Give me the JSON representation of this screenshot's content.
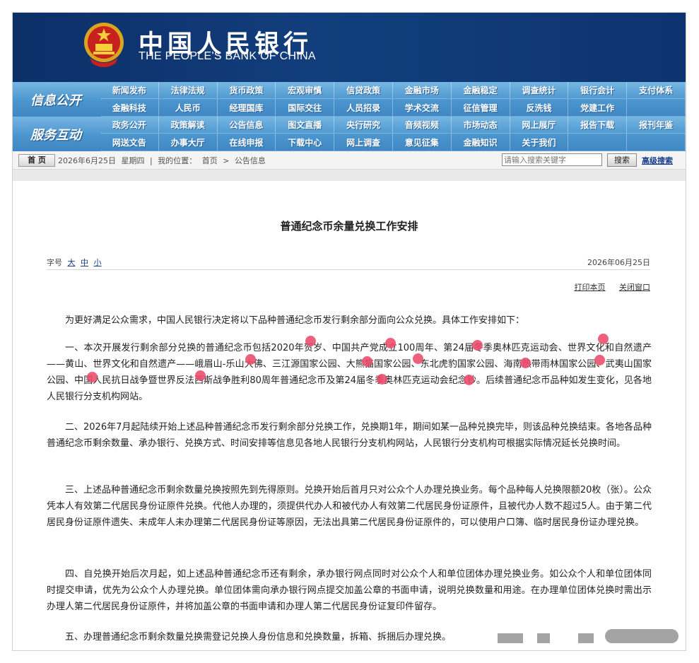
{
  "header": {
    "logo_cn": "中国人民银行",
    "logo_en": "THE PEOPLE'S BANK OF CHINA",
    "brand_color": "#0c2f67"
  },
  "nav_info": {
    "title": "信息公开",
    "items": [
      "新闻发布",
      "法律法规",
      "货币政策",
      "宏观审慎",
      "信贷政策",
      "金融市场",
      "金融稳定",
      "调查统计",
      "银行会计",
      "支付体系",
      "金融科技",
      "人民币",
      "经理国库",
      "国际交往",
      "人员招录",
      "学术交流",
      "征信管理",
      "反洗钱",
      "党建工作",
      ""
    ]
  },
  "nav_service": {
    "title": "服务互动",
    "items": [
      "政务公开",
      "政策解读",
      "公告信息",
      "图文直播",
      "央行研究",
      "音频视频",
      "市场动态",
      "网上展厅",
      "报告下载",
      "报刊年鉴",
      "网送文告",
      "办事大厅",
      "在线申报",
      "下载中心",
      "网上调查",
      "意见征集",
      "金融知识",
      "关于我们",
      "",
      ""
    ]
  },
  "crumb": {
    "home": "首 页",
    "date": "2026年6月25日",
    "weekday": "星期四",
    "location_label": "我的位置：",
    "path": [
      "首页",
      ">",
      "公告信息"
    ],
    "search_placeholder": "请输入搜索关键字",
    "search_button": "搜索",
    "advanced_search": "高级搜索"
  },
  "article": {
    "title": "普通纪念币余量兑换工作安排",
    "font_label": "字号",
    "font_sizes": [
      "大",
      "中",
      "小"
    ],
    "date": "2026年06月25日",
    "print": "打印本页",
    "close": "关闭窗口",
    "paragraphs": [
      "为更好满足公众需求，中国人民银行决定将以下品种普通纪念币发行剩余部分面向公众兑换。具体工作安排如下：",
      "一、本次开展发行剩余部分兑换的普通纪念币包括2020年贺岁、中国共产党成立100周年、第24届冬季奥林匹克运动会、世界文化和自然遗产——黄山、世界文化和自然遗产——峨眉山-乐山大佛、三江源国家公园、大熊猫国家公园、东北虎豹国家公园、海南热带雨林国家公园、武夷山国家公园、中国人民抗日战争暨世界反法西斯战争胜利80周年普通纪念币及第24届冬季奥林匹克运动会纪念钞。后续普通纪念币品种如发生变化，见各地人民银行分支机构网站。",
      "二、2026年7月起陆续开始上述品种普通纪念币发行剩余部分兑换工作，兑换期1年，期间如某一品种兑换完毕，则该品种兑换结束。各地各品种普通纪念币剩余数量、承办银行、兑换方式、时间安排等信息见各地人民银行分支机构网站，人民银行分支机构可根据实际情况延长兑换时间。",
      "三、上述品种普通纪念币剩余数量兑换按照先到先得原则。兑换开始后首月只对公众个人办理兑换业务。每个品种每人兑换限额20枚（张）。公众凭本人有效第二代居民身份证原件兑换。代他人办理的，须提供代办人和被代办人有效第二代居民身份证原件，且被代办人数不超过5人。由于第二代居民身份证原件遗失、未成年人未办理第二代居民身份证等原因，无法出具第二代居民身份证原件的，可以使用户口簿、临时居民身份证办理兑换。",
      "四、自兑换开始后次月起，如上述品种普通纪念币还有剩余，承办银行网点同时对公众个人和单位团体办理兑换业务。如公众个人和单位团体同时提交申请，优先为公众个人办理兑换。单位团体需向承办银行网点提交加盖公章的书面申请，说明兑换数量和用途。在办理单位团体兑换时需出示办理人第二代居民身份证原件，并将加盖公章的书面申请和办理人第二代居民身份证复印件留存。",
      "五、办理普通纪念币剩余数量兑换需登记兑换人身份信息和兑换数量，拆箱、拆捆后办理兑换。"
    ]
  },
  "annotation_color": "#ec4a6a"
}
